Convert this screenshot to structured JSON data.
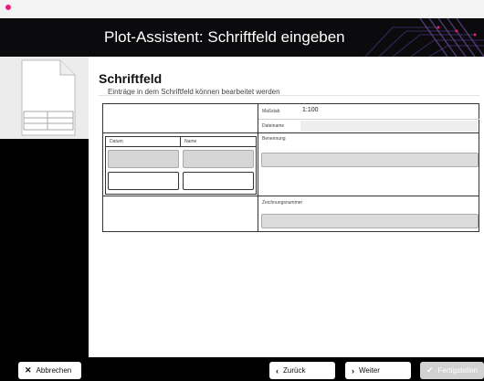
{
  "window": {
    "app_icon": "app-logo-icon"
  },
  "banner": {
    "title": "Plot-Assistent: Schriftfeld eingeben"
  },
  "section": {
    "heading": "Schriftfeld",
    "subtitle": "Einträge in dem Schriftfeld können bearbeitet werden"
  },
  "form": {
    "massstab_label": "Maßstab",
    "massstab_value": "1:100",
    "dateiname_label": "Dateiname",
    "benennung_label": "Benennung",
    "zeichnungsnummer_label": "Zeichnungsnummer",
    "datum_label": "Datum",
    "name_label": "Name"
  },
  "footer": {
    "cancel_label": "Abbrechen",
    "back_label": "Zurück",
    "next_label": "Weiter",
    "finish_label": "Fertigstellen"
  },
  "colors": {
    "banner_bg": "#0b0b0e",
    "accent": "#e11d74",
    "field_gray": "#d6d6d6"
  }
}
